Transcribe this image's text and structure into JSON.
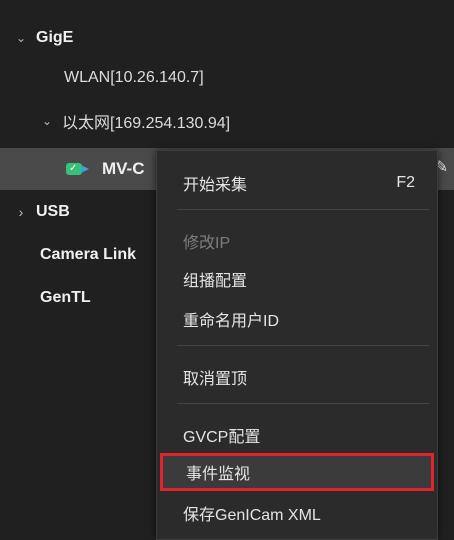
{
  "tree": {
    "gige_label": "GigE",
    "wlan_label": "WLAN[10.26.140.7]",
    "ethernet_label": "以太网[169.254.130.94]",
    "device_label": "MV-C",
    "usb_label": "USB",
    "cameralink_label": "Camera Link",
    "gentl_label": "GenTL"
  },
  "context_menu": {
    "start_capture": "开始采集",
    "start_capture_shortcut": "F2",
    "modify_ip": "修改IP",
    "multicast_config": "组播配置",
    "rename_user_id": "重命名用户ID",
    "unpin": "取消置顶",
    "gvcp_config": "GVCP配置",
    "event_monitor": "事件监视",
    "save_genicam_xml": "保存GenICam XML"
  },
  "colors": {
    "background": "#202020",
    "menu_background": "#2b2b2b",
    "highlight_border": "#e0242f",
    "selected_row": "#4a4a4a",
    "camera_icon": "#39c07a"
  },
  "icons": [
    "chevron-down-icon",
    "chevron-right-icon",
    "camera-connected-icon",
    "edit-icon"
  ]
}
